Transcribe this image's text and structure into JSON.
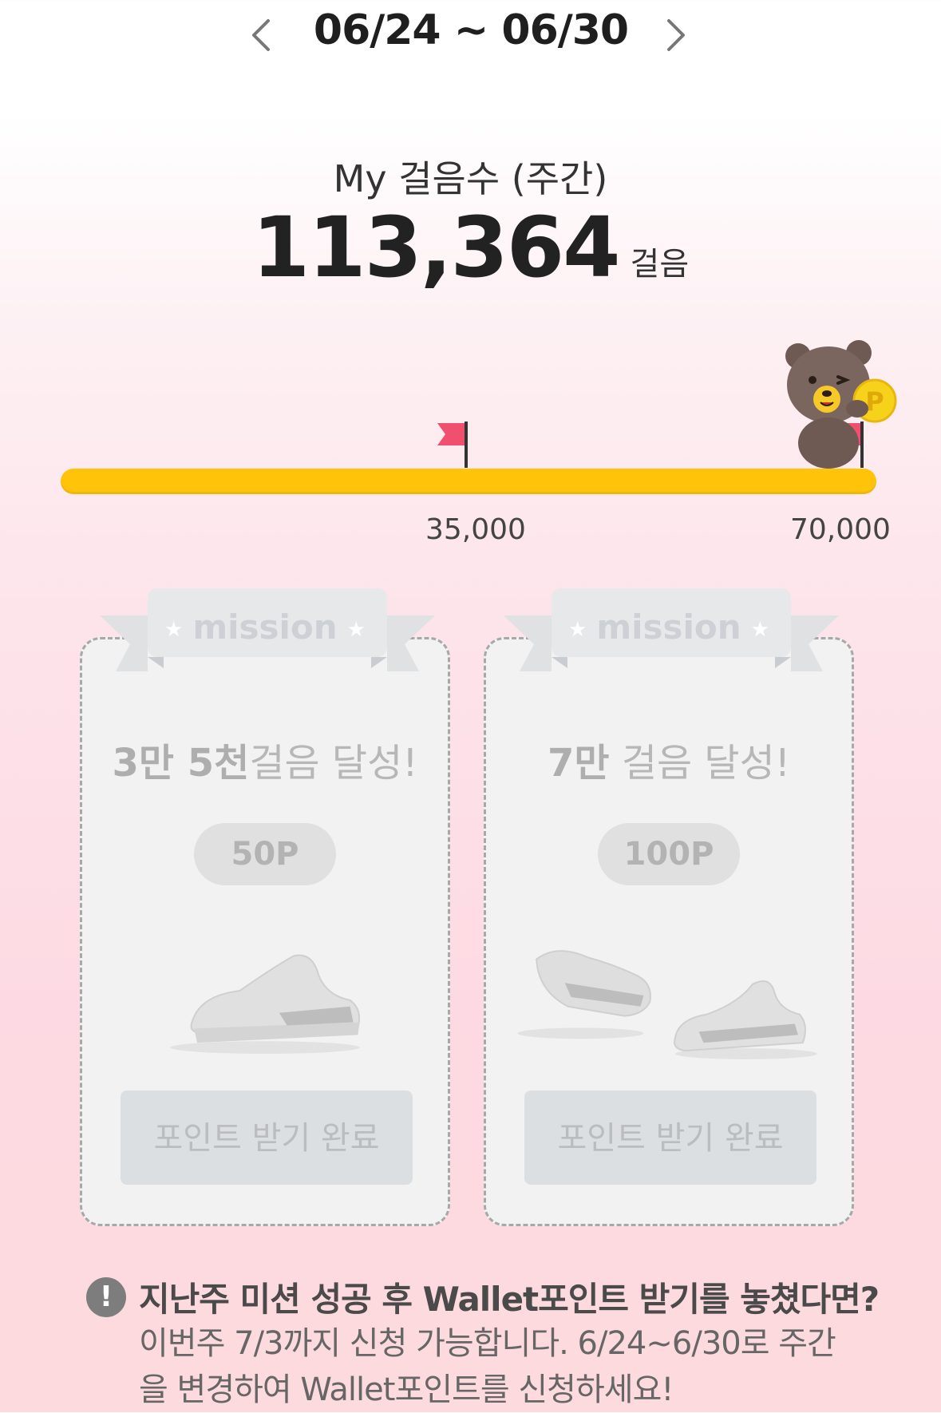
{
  "week_nav": {
    "range": "06/24 ~ 06/30"
  },
  "steps": {
    "title": "My 걸음수 (주간)",
    "value": "113,364",
    "unit": "걸음",
    "progress_fraction": 1.0
  },
  "milestones": [
    {
      "label": "35,000"
    },
    {
      "label": "70,000"
    }
  ],
  "missions": [
    {
      "badge": "mission",
      "goal_bold": "3만 5천",
      "goal_rest": "걸음 달성!",
      "reward": "50P",
      "button": "포인트 받기 완료"
    },
    {
      "badge": "mission",
      "goal_bold": "7만",
      "goal_rest": " 걸음 달성!",
      "reward": "100P",
      "button": "포인트 받기 완료"
    }
  ],
  "notice": {
    "icon": "!",
    "title": "지난주 미션 성공 후 Wallet포인트 받기를 놓쳤다면?",
    "body": "이번주 7/3까지 신청 가능합니다. 6/24~6/30로 주간을 변경하여 Wallet포인트를 신청하세요!"
  },
  "colors": {
    "progress_fill": "#ffc30a",
    "flag": "#f0506e",
    "coin": "#f7d21a"
  }
}
